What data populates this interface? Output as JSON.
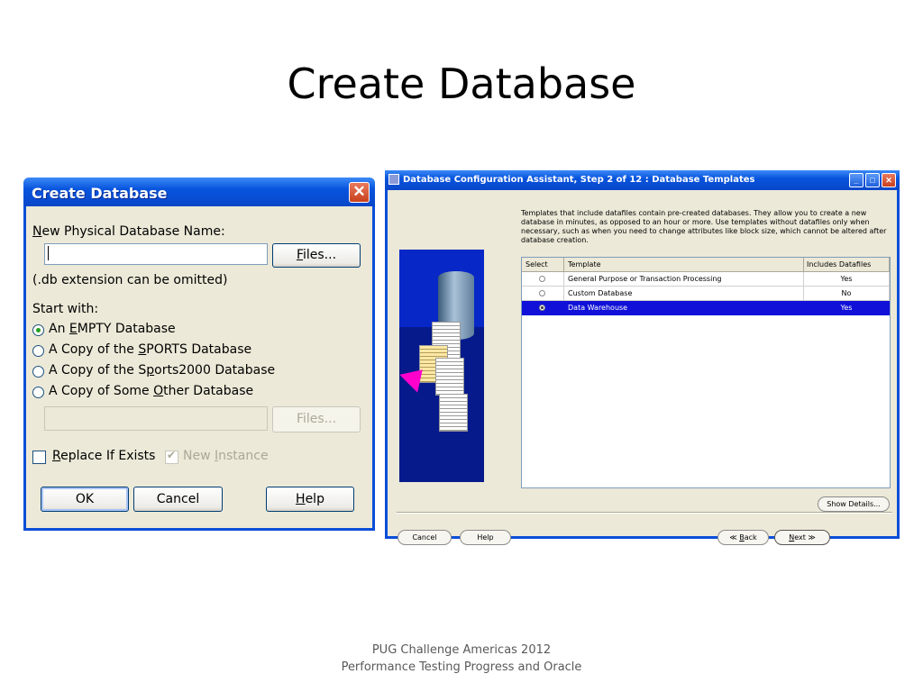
{
  "slide": {
    "title": "Create Database",
    "footer_line1": "PUG Challenge Americas 2012",
    "footer_line2": "Performance Testing Progress and Oracle"
  },
  "create_dialog": {
    "title": "Create Database",
    "close_glyph": "✕",
    "name_label_accel": "N",
    "name_label_rest": "ew Physical Database Name:",
    "name_value": "",
    "files_button_accel": "F",
    "files_button_rest": "iles...",
    "extension_note": "(.db extension can be omitted)",
    "start_with_label": "Start with:",
    "options": [
      {
        "pre": "An ",
        "accel": "E",
        "post": "MPTY Database",
        "selected": true
      },
      {
        "pre": "A Copy of the ",
        "accel": "S",
        "post": "PORTS Database",
        "selected": false
      },
      {
        "pre": "A Copy of the S",
        "accel": "p",
        "post": "orts2000 Database",
        "selected": false
      },
      {
        "pre": "A Copy of Some ",
        "accel": "O",
        "post": "ther Database",
        "selected": false
      }
    ],
    "other_db_value": "",
    "files_button2": "Files...",
    "replace_accel": "R",
    "replace_rest": "eplace If Exists",
    "replace_checked": false,
    "new_instance_pre": "New ",
    "new_instance_accel": "I",
    "new_instance_post": "nstance",
    "new_instance_checked": true,
    "ok_label": "OK",
    "cancel_label": "Cancel",
    "help_accel": "H",
    "help_rest": "elp"
  },
  "dbca_window": {
    "title": "Database Configuration Assistant, Step 2 of 12 : Database Templates",
    "description": "Templates that include datafiles contain pre-created databases. They allow you to create a new database in minutes, as opposed to an hour or more. Use templates without datafiles only when necessary, such as when you need to change attributes like block size, which cannot be altered after database creation.",
    "table": {
      "headers": [
        "Select",
        "Template",
        "Includes Datafiles"
      ],
      "rows": [
        {
          "template": "General Purpose or Transaction Processing",
          "includes": "Yes",
          "selected": false
        },
        {
          "template": "Custom Database",
          "includes": "No",
          "selected": false
        },
        {
          "template": "Data Warehouse",
          "includes": "Yes",
          "selected": true
        }
      ]
    },
    "show_details": "Show Details...",
    "cancel": "Cancel",
    "help": "Help",
    "back_arrow": "≪",
    "back_accel": "B",
    "back_rest": "ack",
    "next_accel": "N",
    "next_rest": "ext",
    "next_arrow": "≫",
    "minimize_glyph": "_",
    "maximize_glyph": "□",
    "close_glyph": "✕"
  },
  "colors": {
    "xp_titlebar": "#0855dd",
    "dialog_face": "#ece9d8",
    "selection": "#1010d8",
    "arrow_magenta": "#ff00cc"
  }
}
